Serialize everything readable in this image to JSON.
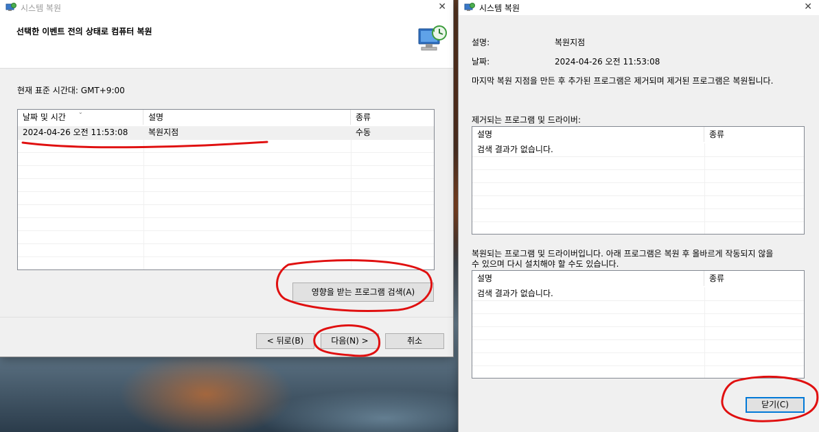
{
  "left_window": {
    "title": "시스템 복원",
    "heading": "선택한 이벤트 전의 상태로 컴퓨터 복원",
    "timezone": "현재 표준 시간대: GMT+9:00",
    "table": {
      "columns": [
        "날짜 및 시간",
        "설명",
        "종류"
      ],
      "rows": [
        {
          "datetime": "2024-04-26 오전 11:53:08",
          "description": "복원지점",
          "type": "수동"
        }
      ]
    },
    "scan_button": "영향을 받는 프로그램 검색(A)",
    "back_button": "< 뒤로(B)",
    "next_button": "다음(N) >",
    "cancel_button": "취소"
  },
  "right_window": {
    "title": "시스템 복원",
    "description_label": "설명:",
    "description_value": "복원지점",
    "date_label": "날짜:",
    "date_value": "2024-04-26 오전 11:53:08",
    "info": "마지막 복원 지점을 만든 후 추가된 프로그램은 제거되며 제거된 프로그램은 복원됩니다.",
    "removed_label": "제거되는 프로그램 및 드라이버:",
    "removed_table": {
      "columns": [
        "설명",
        "종류"
      ],
      "empty_text": "검색 결과가 없습니다."
    },
    "restored_label_line1": "복원되는 프로그램 및 드라이버입니다. 아래 프로그램은 복원 후 올바르게 작동되지 않을",
    "restored_label_line2": "수 있으며 다시 설치해야 할 수도 있습니다.",
    "restored_table": {
      "columns": [
        "설명",
        "종류"
      ],
      "empty_text": "검색 결과가 없습니다."
    },
    "close_button": "닫기(C)"
  },
  "colors": {
    "annotation": "#e01010",
    "focus_border": "#0078d7"
  }
}
